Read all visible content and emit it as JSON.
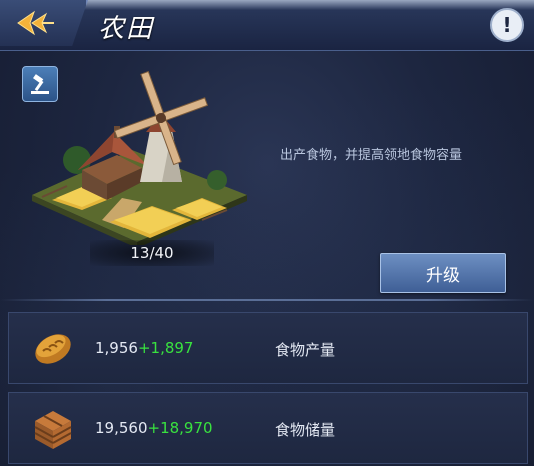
{
  "header": {
    "title": "农田",
    "back_icon": "back-arrow-icon",
    "info_icon_text": "!"
  },
  "building": {
    "name": "windmill-farm",
    "progress_text": "13/40",
    "description": "出产食物，并提高领地食物容量"
  },
  "upgrade": {
    "label": "升级"
  },
  "stats": [
    {
      "icon": "bread-icon",
      "value": "1,956",
      "bonus": "+1,897",
      "label": "食物产量"
    },
    {
      "icon": "crate-icon",
      "value": "19,560",
      "bonus": "+18,970",
      "label": "食物储量"
    }
  ],
  "colors": {
    "accent": "#6d8fc2",
    "bonus_green": "#39e23f",
    "background": "#1d2640"
  }
}
